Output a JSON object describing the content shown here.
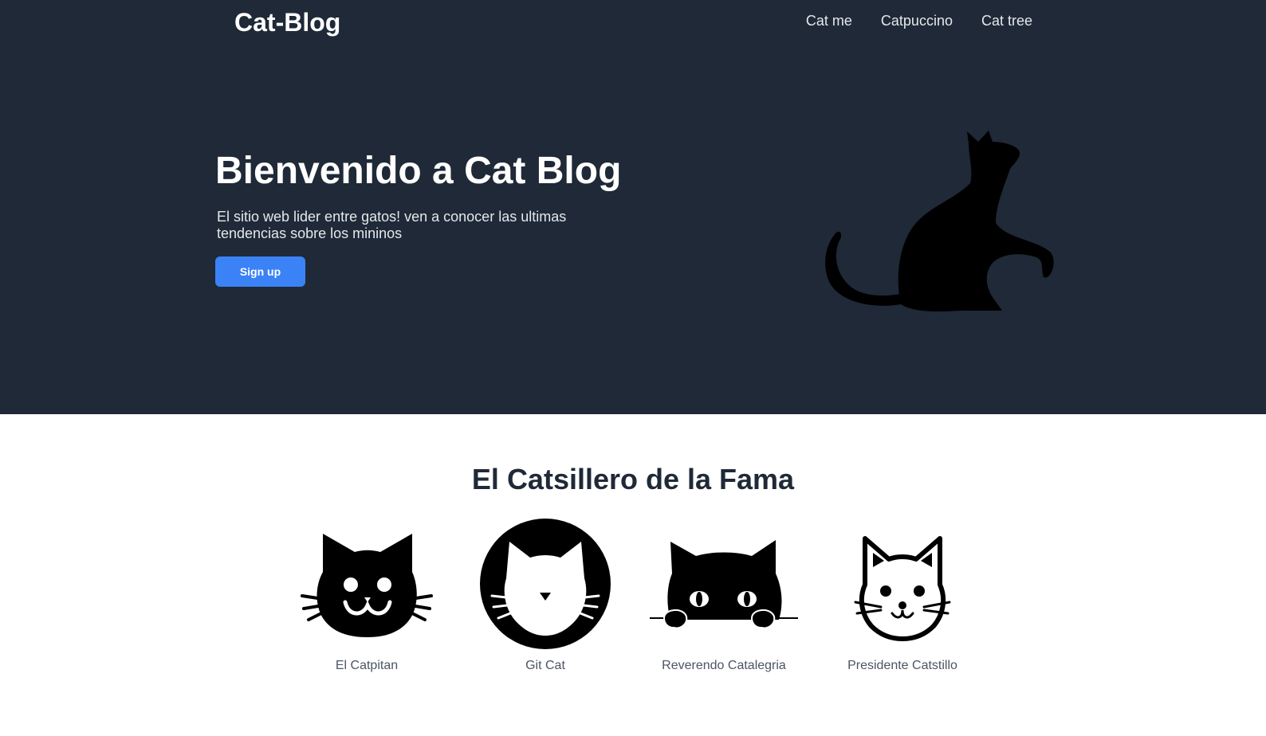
{
  "header": {
    "brand": "Cat-Blog",
    "nav": [
      "Cat me",
      "Catpuccino",
      "Cat tree"
    ]
  },
  "hero": {
    "title": "Bienvenido a Cat Blog",
    "subtitle": "El sitio web lider entre gatos! ven a conocer las ultimas tendencias sobre los mininos",
    "button": "Sign up",
    "image_icon": "sitting-cat-silhouette-icon"
  },
  "hall_of_fame": {
    "title": "El Catsillero de la Fama",
    "cats": [
      {
        "name": "El Catpitan",
        "icon": "smiling-cat-face-icon"
      },
      {
        "name": "Git Cat",
        "icon": "cat-in-circle-icon"
      },
      {
        "name": "Reverendo Catalegria",
        "icon": "peeking-cat-icon"
      },
      {
        "name": "Presidente Catstillo",
        "icon": "outlined-cat-face-icon"
      }
    ]
  },
  "colors": {
    "hero_bg": "#1f2937",
    "accent": "#3b82f6",
    "heading_dark": "#1f2937"
  }
}
